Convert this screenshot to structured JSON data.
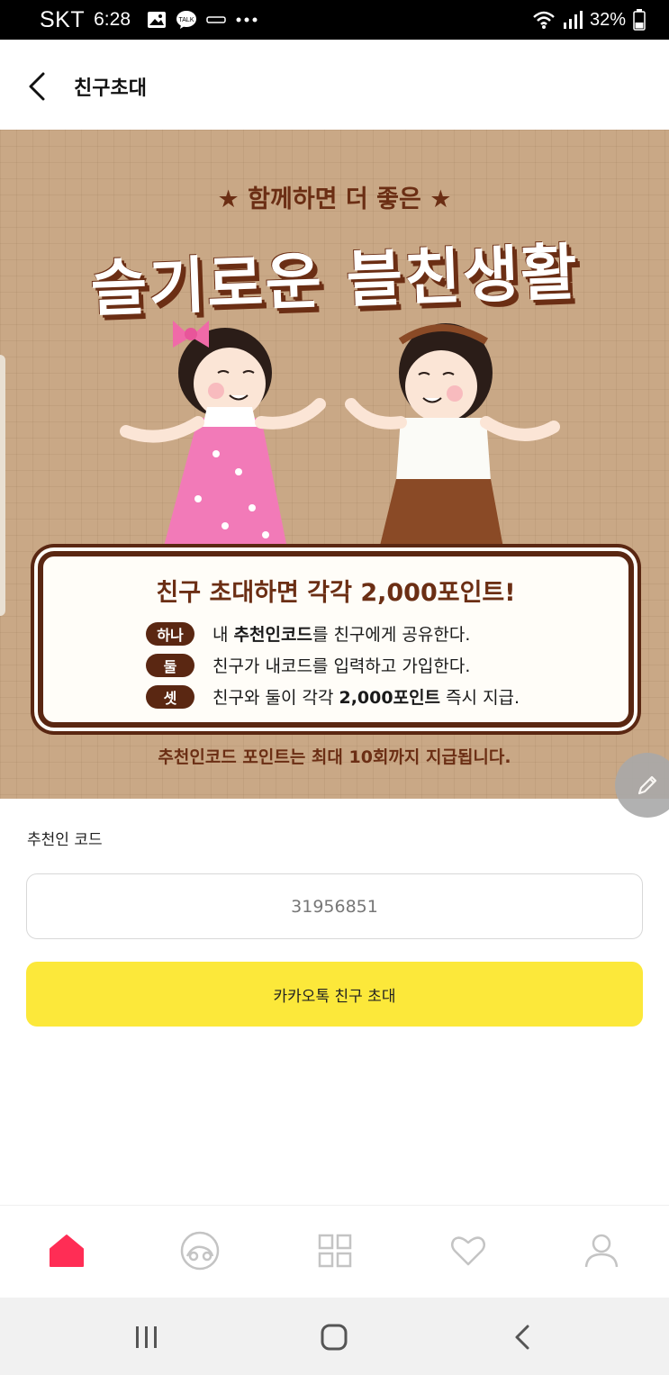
{
  "status_bar": {
    "carrier": "SKT",
    "time": "6:28",
    "battery": "32%"
  },
  "header": {
    "title": "친구초대"
  },
  "banner": {
    "subtitle": "★ 함께하면 더 좋은 ★",
    "title": "슬기로운 블친생활",
    "card_heading": "친구 초대하면 각각 2,000포인트!",
    "steps": [
      {
        "badge": "하나",
        "prefix": "내 ",
        "bold": "추천인코드",
        "suffix": "를 친구에게 공유한다."
      },
      {
        "badge": "둘",
        "prefix": "친구가 내코드를 입력하고 가입한다.",
        "bold": "",
        "suffix": ""
      },
      {
        "badge": "셋",
        "prefix": "친구와 둘이 각각 ",
        "bold": "2,000포인트",
        "suffix": " 즉시 지급."
      }
    ],
    "note": "추천인코드 포인트는 최대 10회까지 지급됩니다."
  },
  "form": {
    "code_label": "추천인 코드",
    "code_value": "31956851",
    "invite_button_label": "카카오톡 친구 초대"
  },
  "bottom_nav": {
    "items": [
      "home-icon",
      "discover-icon",
      "grid-icon",
      "heart-icon",
      "profile-icon"
    ],
    "active_color": "#ff2d55",
    "inactive_color": "#c4c4c4"
  },
  "colors": {
    "banner_bg": "#c9a886",
    "brown": "#5a2712",
    "accent_yellow": "#fce83a"
  }
}
